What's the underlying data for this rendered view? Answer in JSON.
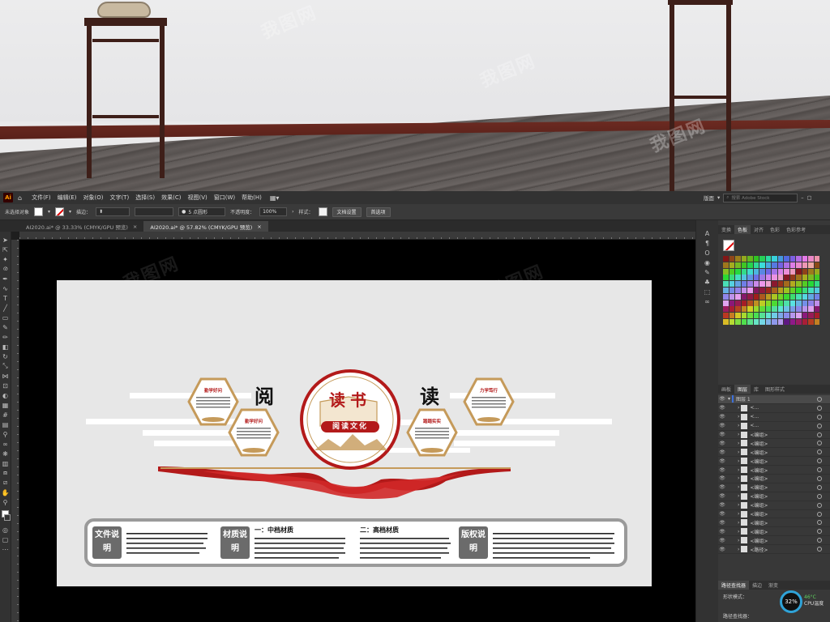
{
  "menubar": {
    "logo": "Ai",
    "items": [
      "文件(F)",
      "编辑(E)",
      "对象(O)",
      "文字(T)",
      "选择(S)",
      "效果(C)",
      "视图(V)",
      "窗口(W)",
      "帮助(H)"
    ]
  },
  "topright": {
    "workspace": "版面",
    "search_placeholder": "搜索 Adobe Stock"
  },
  "control": {
    "selection": "未选择对象",
    "stroke_label": "描边：",
    "stroke_preset": "5 点圆形",
    "opacity_label": "不透明度：",
    "opacity_value": "100%",
    "style_label": "样式：",
    "doc_setup": "文档设置",
    "prefs": "首选项"
  },
  "tabs": [
    {
      "label": "AI2020.ai* @ 33.33% (CMYK/GPU 预览)",
      "active": false
    },
    {
      "label": "AI2020.ai* @ 57.82% (CMYK/GPU 预览)",
      "active": true
    }
  ],
  "ruler": [
    "100",
    "150",
    "200",
    "250",
    "300",
    "350",
    "400",
    "450",
    "500",
    "550",
    "600",
    "650",
    "700",
    "750",
    "800"
  ],
  "art": {
    "center_title": "读书",
    "center_sub": "阅读文化",
    "left_big": "阅",
    "right_big": "读",
    "hex1": "勤学好问",
    "hex2": "勤学好问",
    "hex3": "踏踏实实",
    "hex4": "力学笃行",
    "label_file": "文件说明",
    "label_material": "材质说明",
    "label_copyright": "版权说明",
    "mid_title": "一：中档材质",
    "high_title": "二：高档材质"
  },
  "panels": {
    "swatch_tabs": [
      "变换",
      "色板",
      "对齐",
      "色彩",
      "色彩参考"
    ],
    "layer_tabs": [
      "画板",
      "图层",
      "库",
      "图形样式"
    ],
    "layer_top": "图层 1",
    "layers": [
      "<...",
      "<...",
      "<...",
      "<编组>",
      "<编组>",
      "<编组>",
      "<编组>",
      "<编组>",
      "<编组>",
      "<编组>",
      "<编组>",
      "<编组>",
      "<编组>",
      "<编组>",
      "<编组>",
      "<编组>",
      "<路径>"
    ],
    "bottom_tabs": [
      "路径查找器",
      "描边",
      "渐变"
    ],
    "shape_mode": "形状模式：",
    "pathfinder": "路径查找器："
  },
  "status": {
    "cpu_percent": "32%",
    "temp": "46°C",
    "temp_label": "CPU温度"
  },
  "watermark": "我图网",
  "colors": {
    "accent_red": "#b31a1a",
    "gold": "#c59a5a",
    "panel_bg": "#383838"
  }
}
